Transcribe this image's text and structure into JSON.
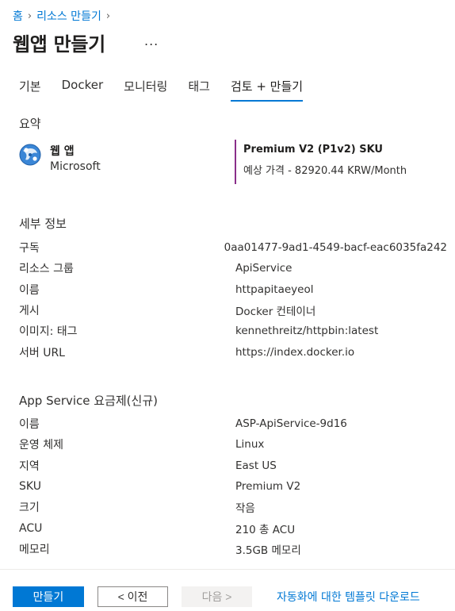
{
  "breadcrumb": {
    "home": "홈",
    "create_resource": "리소스 만들기"
  },
  "page": {
    "title": "웹앱 만들기",
    "more": "..."
  },
  "tabs": [
    {
      "label": "기본"
    },
    {
      "label": "Docker"
    },
    {
      "label": "모니터링"
    },
    {
      "label": "태그"
    },
    {
      "label": "검토 + 만들기"
    }
  ],
  "summary": {
    "heading": "요약",
    "app_name": "웹 앱",
    "vendor": "Microsoft",
    "sku_title": "Premium V2 (P1v2) SKU",
    "sku_price": "예상 가격 - 82920.44 KRW/Month"
  },
  "details": {
    "heading": "세부 정보",
    "rows": [
      {
        "key": "구독",
        "value": "0aa01477-9ad1-4549-bacf-eac6035fa242"
      },
      {
        "key": "리소스 그룹",
        "value": "ApiService"
      },
      {
        "key": "이름",
        "value": "httpapitaeyeol"
      },
      {
        "key": "게시",
        "value": "Docker 컨테이너"
      },
      {
        "key": "이미지: 태그",
        "value": "kennethreitz/httpbin:latest"
      },
      {
        "key": "서버 URL",
        "value": "https://index.docker.io"
      }
    ]
  },
  "plan": {
    "heading": "App Service 요금제(신규)",
    "rows": [
      {
        "key": "이름",
        "value": "ASP-ApiService-9d16"
      },
      {
        "key": "운영 체제",
        "value": "Linux"
      },
      {
        "key": "지역",
        "value": "East US"
      },
      {
        "key": "SKU",
        "value": "Premium V2"
      },
      {
        "key": "크기",
        "value": "작음"
      },
      {
        "key": "ACU",
        "value": "210 총 ACU"
      },
      {
        "key": "메모리",
        "value": "3.5GB 메모리"
      }
    ]
  },
  "footer": {
    "create": "만들기",
    "previous": "< 이전",
    "next": "다음 >",
    "download_template": "자동화에 대한 템플릿 다운로드"
  },
  "colors": {
    "accent": "#0078d4",
    "sku_bar": "#8a2f8a"
  }
}
